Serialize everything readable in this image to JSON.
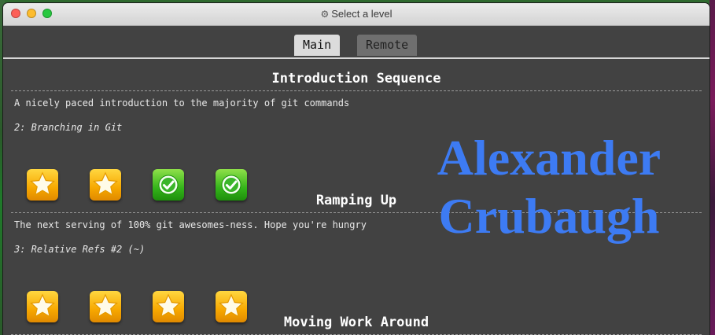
{
  "window": {
    "title": "Select a level"
  },
  "tabs": [
    {
      "label": "Main",
      "active": true
    },
    {
      "label": "Remote",
      "active": false
    }
  ],
  "sequences": [
    {
      "title": "Introduction Sequence",
      "description": "A nicely paced introduction to the majority of git commands",
      "current_level": "2: Branching in Git",
      "levels": [
        "star",
        "star",
        "check",
        "check"
      ]
    },
    {
      "title": "Ramping Up",
      "description": "The next serving of 100% git awesomes-ness. Hope you're hungry",
      "current_level": "3: Relative Refs #2 (~)",
      "levels": [
        "star",
        "star",
        "star",
        "star"
      ]
    },
    {
      "title": "Moving Work Around"
    }
  ],
  "watermark": {
    "line1": "Alexander",
    "line2": "Crubaugh",
    "color": "#3d7bf3"
  },
  "colors": {
    "star_tile": "#f7a800",
    "check_tile": "#34b41a",
    "panel_bg": "#424242"
  }
}
